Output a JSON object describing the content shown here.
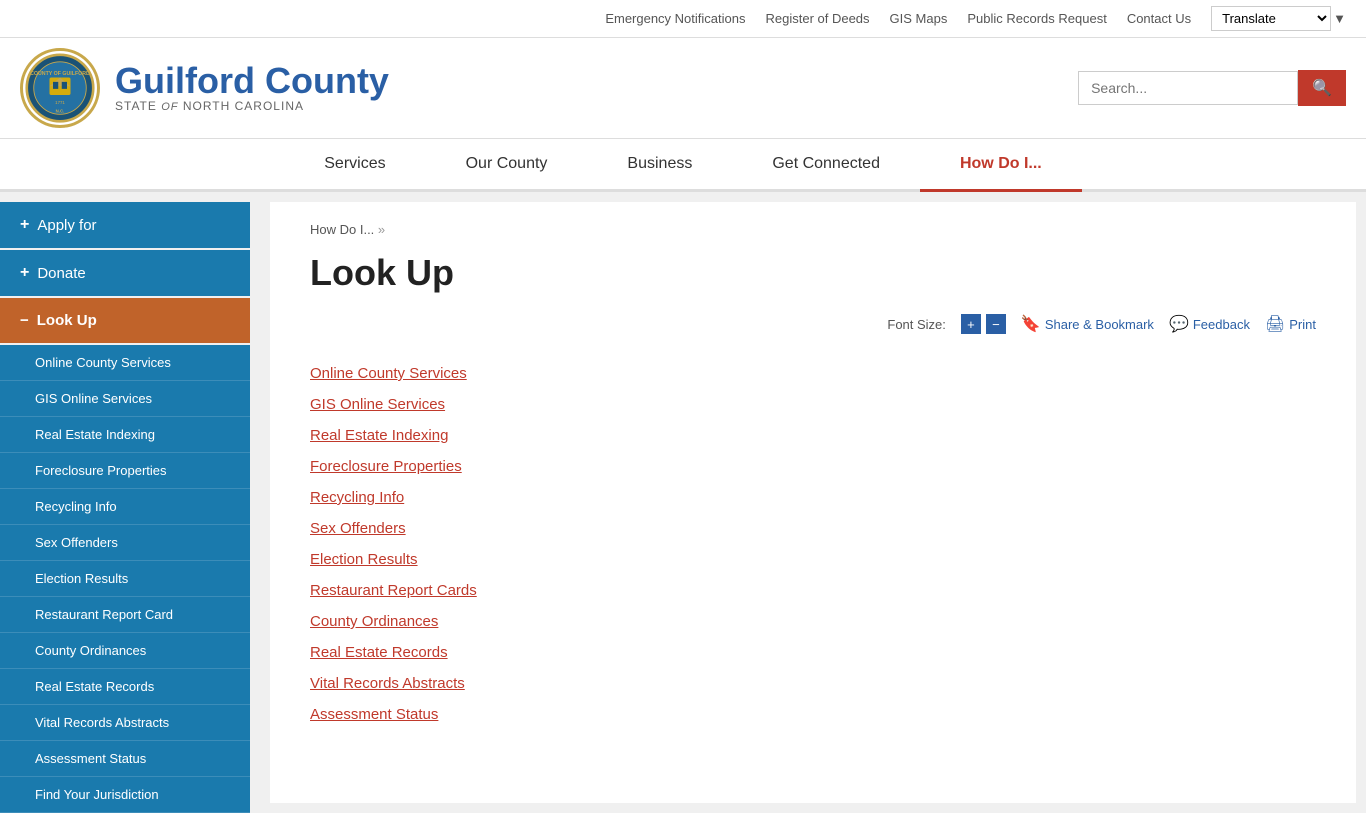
{
  "topbar": {
    "links": [
      {
        "label": "Emergency Notifications",
        "name": "emergency-notifications-link"
      },
      {
        "label": "Register of Deeds",
        "name": "register-of-deeds-link"
      },
      {
        "label": "GIS Maps",
        "name": "gis-maps-link"
      },
      {
        "label": "Public Records Request",
        "name": "public-records-request-link"
      },
      {
        "label": "Contact Us",
        "name": "contact-us-link"
      }
    ],
    "translate_label": "Translate"
  },
  "header": {
    "site_name": "Guilford County",
    "state": "STATE",
    "of": "of",
    "north_carolina": "NORTH CAROLINA",
    "search_placeholder": "Search..."
  },
  "mainnav": {
    "items": [
      {
        "label": "Services",
        "active": false
      },
      {
        "label": "Our County",
        "active": false
      },
      {
        "label": "Business",
        "active": false
      },
      {
        "label": "Get Connected",
        "active": false
      },
      {
        "label": "How Do I...",
        "active": true
      }
    ]
  },
  "sidebar": {
    "top_items": [
      {
        "label": "Apply for",
        "prefix": "+"
      },
      {
        "label": "Donate",
        "prefix": "+"
      }
    ],
    "active_item": {
      "label": "Look Up",
      "prefix": "−"
    },
    "sub_items": [
      {
        "label": "Online County Services"
      },
      {
        "label": "GIS Online Services"
      },
      {
        "label": "Real Estate Indexing"
      },
      {
        "label": "Foreclosure Properties"
      },
      {
        "label": "Recycling Info"
      },
      {
        "label": "Sex Offenders"
      },
      {
        "label": "Election Results"
      },
      {
        "label": "Restaurant Report Card"
      },
      {
        "label": "County Ordinances"
      },
      {
        "label": "Real Estate Records"
      },
      {
        "label": "Vital Records Abstracts"
      },
      {
        "label": "Assessment Status"
      },
      {
        "label": "Find Your Jurisdiction"
      }
    ]
  },
  "breadcrumb": {
    "parent": "How Do I...",
    "separator": "»"
  },
  "content": {
    "title": "Look Up",
    "font_size_label": "Font Size:",
    "toolbar_actions": [
      {
        "label": "Share & Bookmark",
        "icon": "🔖"
      },
      {
        "label": "Feedback",
        "icon": "💬"
      },
      {
        "label": "Print",
        "icon": "🖨"
      }
    ],
    "links": [
      "Online County Services",
      "GIS Online Services ",
      "Real Estate Indexing ",
      "Foreclosure Properties",
      "Recycling Info ",
      "Sex Offenders",
      "Election Results",
      "Restaurant Report Cards",
      "County Ordinances",
      "Real Estate Records",
      "Vital Records Abstracts",
      "Assessment Status"
    ]
  }
}
